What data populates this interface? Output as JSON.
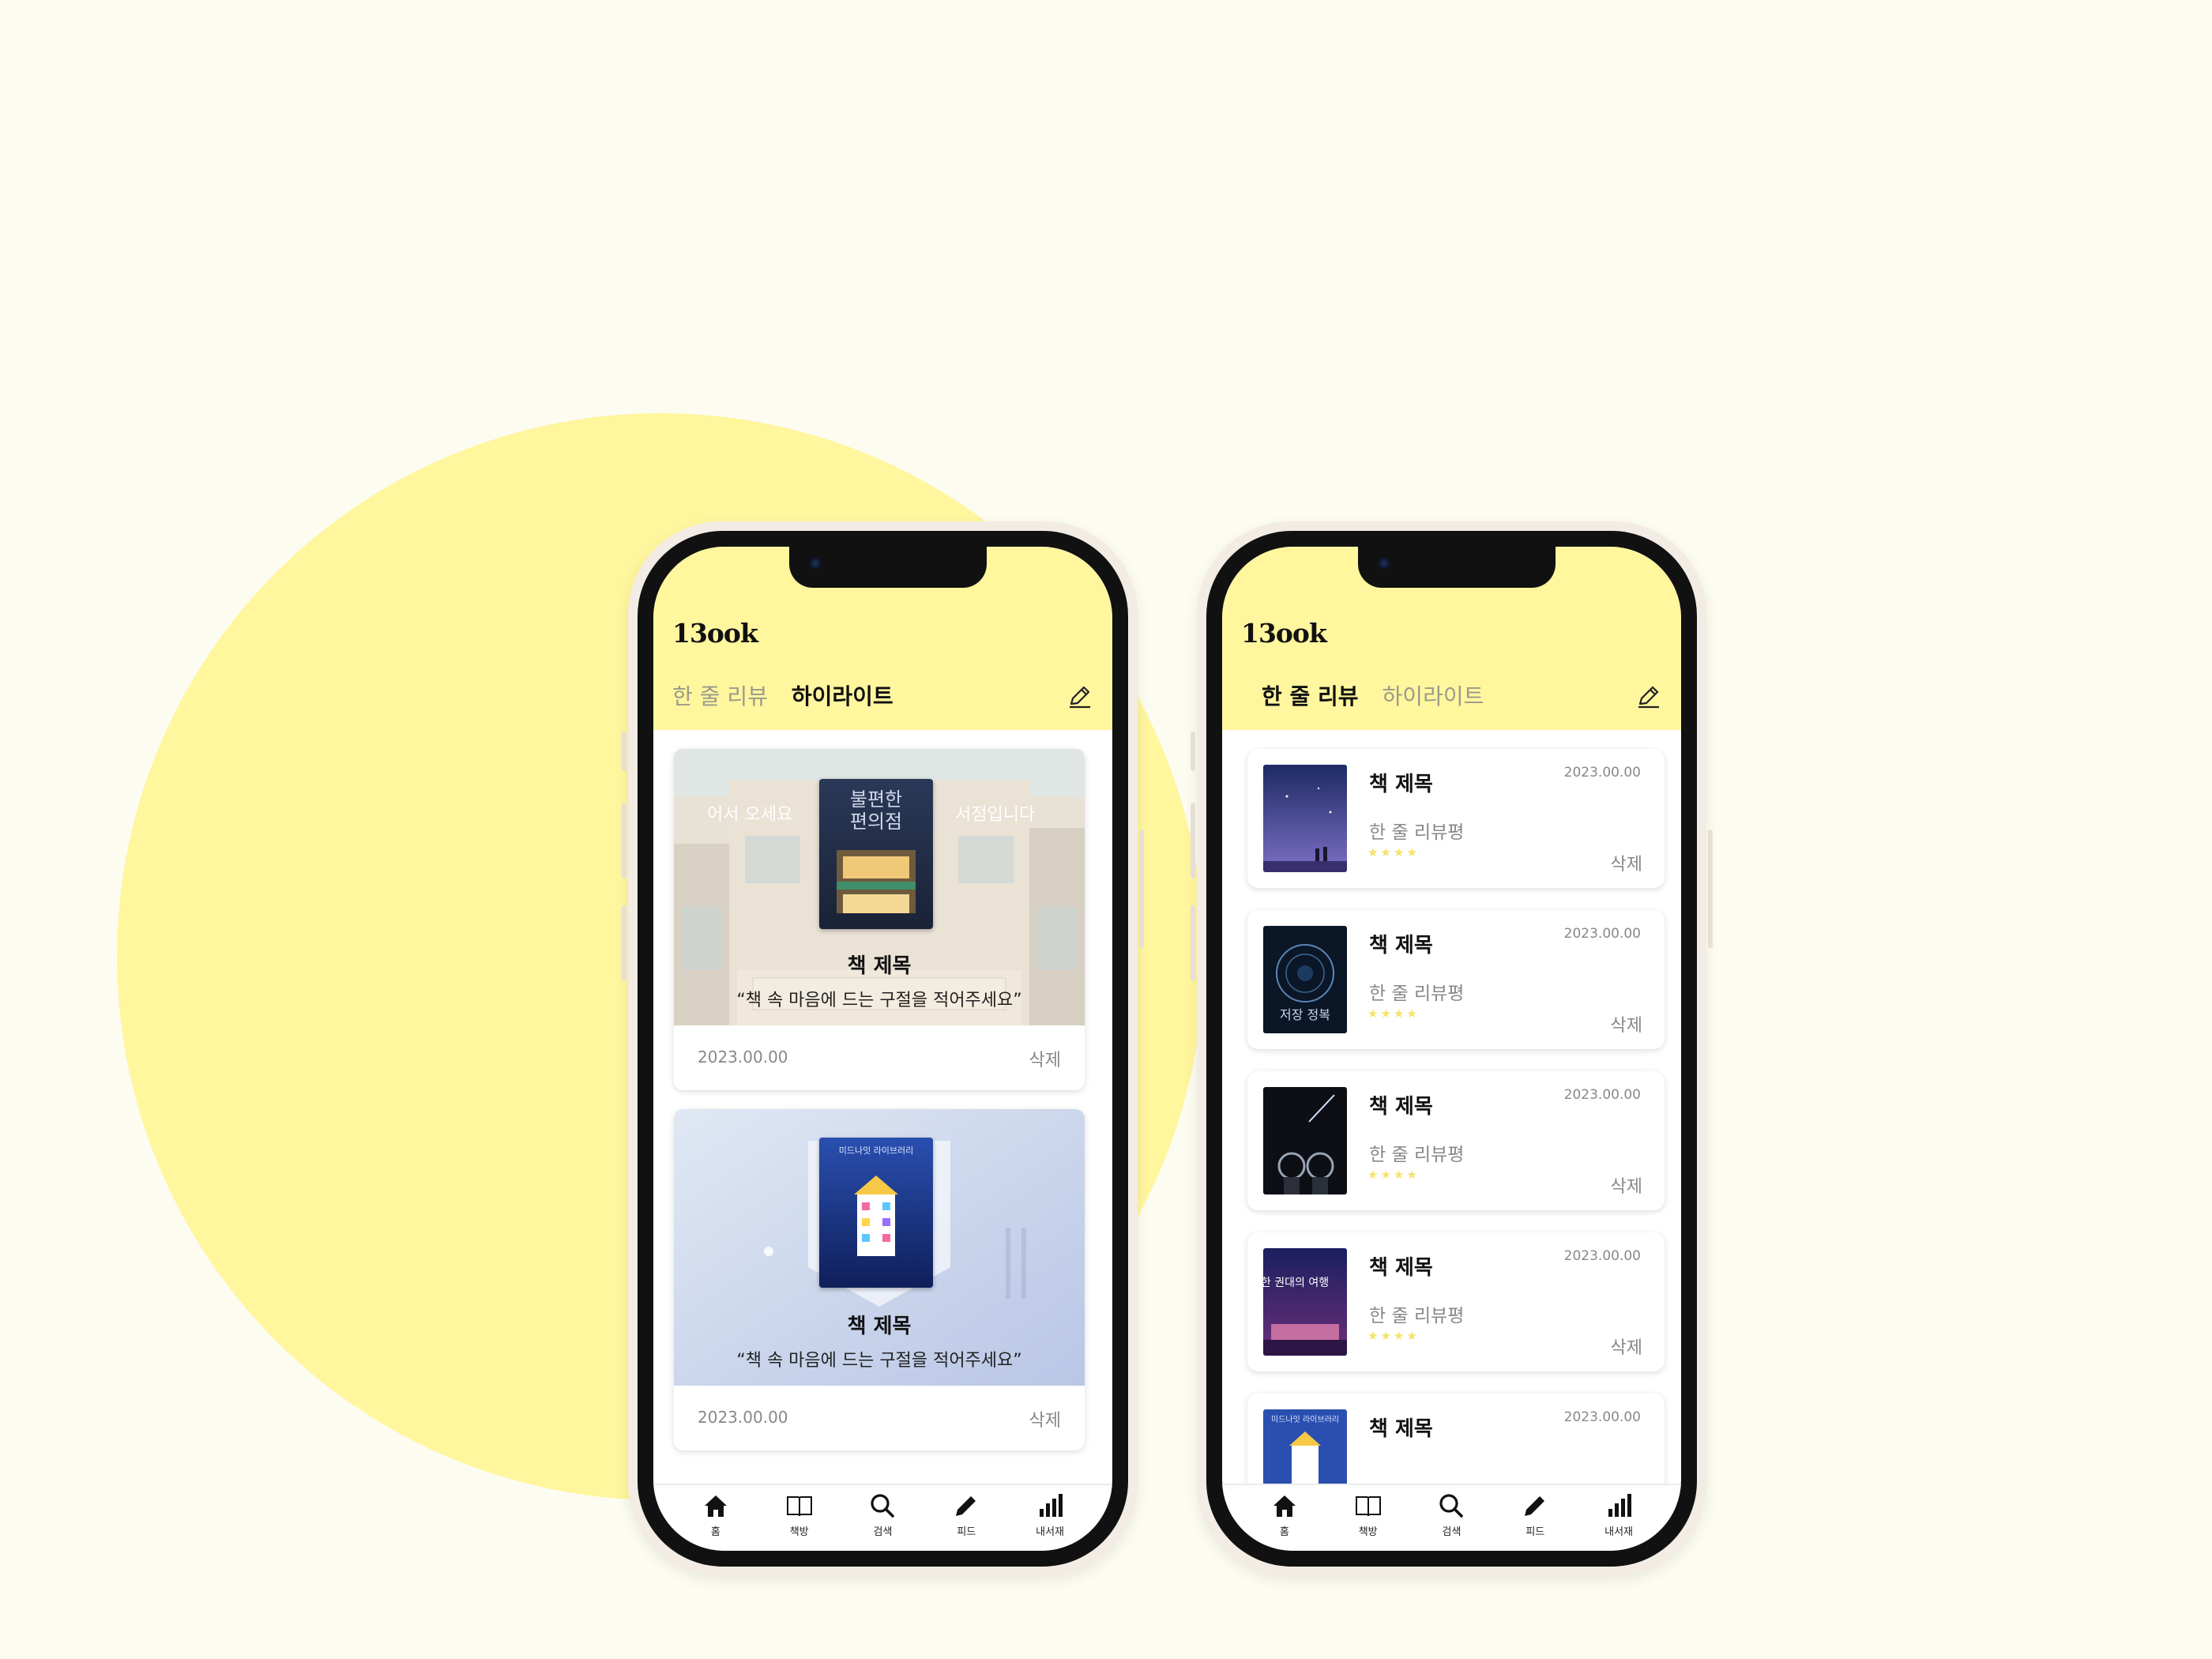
{
  "colors": {
    "background": "#fdfcf1",
    "accent_yellow": "#fff69e",
    "star": "#f5e267",
    "text_dark": "#111111",
    "text_gray": "#888888"
  },
  "left_phone": {
    "logo": "13ook",
    "tabs": [
      {
        "label": "한 줄 리뷰",
        "active": false
      },
      {
        "label": "하이라이트",
        "active": true
      }
    ],
    "edit_icon": "pencil-icon",
    "cover_text": {
      "left": "어서 오세요",
      "title": "불편한 편의점",
      "right": "서점입니다",
      "cover2": "미드나잇 라이브러리"
    },
    "highlights": [
      {
        "title": "책 제목",
        "quote": "“책 속 마음에 드는 구절을 적어주세요”",
        "date": "2023.00.00",
        "delete": "삭제"
      },
      {
        "title": "책 제목",
        "quote": "“책 속 마음에 드는 구절을 적어주세요”",
        "date": "2023.00.00",
        "delete": "삭제"
      }
    ]
  },
  "right_phone": {
    "logo": "13ook",
    "tabs": [
      {
        "label": "한 줄 리뷰",
        "active": true
      },
      {
        "label": "하이라이트",
        "active": false
      }
    ],
    "edit_icon": "pencil-icon",
    "reviews": [
      {
        "title": "책 제목",
        "date": "2023.00.00",
        "text": "한 줄 리뷰평",
        "stars": "★★★★",
        "delete": "삭제"
      },
      {
        "title": "책 제목",
        "date": "2023.00.00",
        "text": "한 줄 리뷰평",
        "stars": "★★★★",
        "delete": "삭제"
      },
      {
        "title": "책 제목",
        "date": "2023.00.00",
        "text": "한 줄 리뷰평",
        "stars": "★★★★",
        "delete": "삭제"
      },
      {
        "title": "책 제목",
        "date": "2023.00.00",
        "text": "한 줄 리뷰평",
        "stars": "★★★★",
        "delete": "삭제"
      },
      {
        "title": "책 제목",
        "date": "2023.00.00"
      }
    ],
    "cover_text": {
      "c2": "저장 정복",
      "c4": "한 권대의 여행",
      "c5": "미드나잇 라이브러리"
    }
  },
  "tabbar": [
    {
      "label": "홈",
      "icon": "home-icon"
    },
    {
      "label": "책방",
      "icon": "book-open-icon"
    },
    {
      "label": "검색",
      "icon": "search-icon"
    },
    {
      "label": "피드",
      "icon": "pencil-icon"
    },
    {
      "label": "내서재",
      "icon": "bar-chart-icon"
    }
  ]
}
